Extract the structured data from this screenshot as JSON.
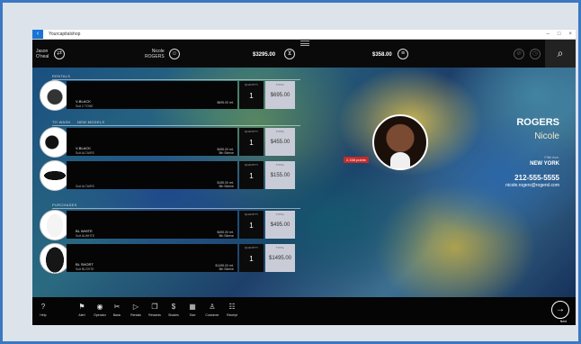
{
  "window": {
    "title": "Yourcapitalshop",
    "min": "–",
    "max": "□",
    "close": "×"
  },
  "topbar": {
    "user": {
      "first": "Jason",
      "last": "O'neal"
    },
    "customer": {
      "first": "Nicole",
      "last": "ROGERS"
    },
    "cart_total": "$3295.00",
    "paid_total": "$358.00"
  },
  "sections": {
    "first": "RENTALS",
    "second": "TO WASH",
    "second_sub": "NEW MODELS",
    "third": "PURCHASES"
  },
  "items": [
    {
      "name": "V-BLACK",
      "sub": "Suit 2 TONE",
      "price": "$695.00 ret.",
      "extra": "",
      "qty_label": "QUANTITY",
      "qty": "1",
      "total_label": "TOTAL",
      "total": "$695.00"
    },
    {
      "name": "V-BLACK",
      "sub": "Suit ALTAIRS",
      "price": "$455.00 ret.",
      "extra": "5th Sleeve",
      "qty_label": "QUANTITY",
      "qty": "1",
      "total_label": "TOTAL",
      "total": "$455.00"
    },
    {
      "name": "",
      "sub": "Suit ALTAIRS",
      "price": "$155.00 ret.",
      "extra": "5th Sleeve",
      "qty_label": "QUANTITY",
      "qty": "1",
      "total_label": "TOTAL",
      "total": "$155.00"
    },
    {
      "name": "BL WHITE",
      "sub": "Suit ALWHTE",
      "price": "$495.00 ret.",
      "extra": "5th Sleeve",
      "qty_label": "QUANTITY",
      "qty": "1",
      "total_label": "TOTAL",
      "total": "$495.00"
    },
    {
      "name": "BL SHORT",
      "sub": "Suit BLSHTE",
      "price": "$1495.00 ret.",
      "extra": "5th Sleeve",
      "qty_label": "QUANTITY",
      "qty": "1",
      "total_label": "TOTAL",
      "total": "$1495.00"
    }
  ],
  "customer": {
    "last": "ROGERS",
    "first": "Nicole",
    "address": "Fifth Ave.",
    "city": "NEW YORK",
    "phone": "212-555-5555",
    "email": "nicole.rogers@rogersl.com",
    "points": "2,158 points"
  },
  "toolbar": [
    {
      "icon": "?",
      "label": "Help",
      "name": "help"
    },
    {
      "icon": "⚑",
      "label": "Alert",
      "name": "alert"
    },
    {
      "icon": "◉",
      "label": "Operator",
      "name": "operator"
    },
    {
      "icon": "✂",
      "label": "Basic",
      "name": "basic"
    },
    {
      "icon": "▷",
      "label": "Rentals",
      "name": "rentals"
    },
    {
      "icon": "❐",
      "label": "Rewards",
      "name": "rewards"
    },
    {
      "icon": "$",
      "label": "Shades",
      "name": "shades"
    },
    {
      "icon": "▦",
      "label": "Size",
      "name": "size"
    },
    {
      "icon": "♙",
      "label": "Customer",
      "name": "customer"
    },
    {
      "icon": "☷",
      "label": "Receipt",
      "name": "receipt"
    }
  ],
  "next": {
    "icon": "→",
    "label": "Next"
  },
  "colors": {
    "frame": "#3a78c2",
    "badge": "#c42b2b",
    "total_bg": "#c9ccd6"
  }
}
